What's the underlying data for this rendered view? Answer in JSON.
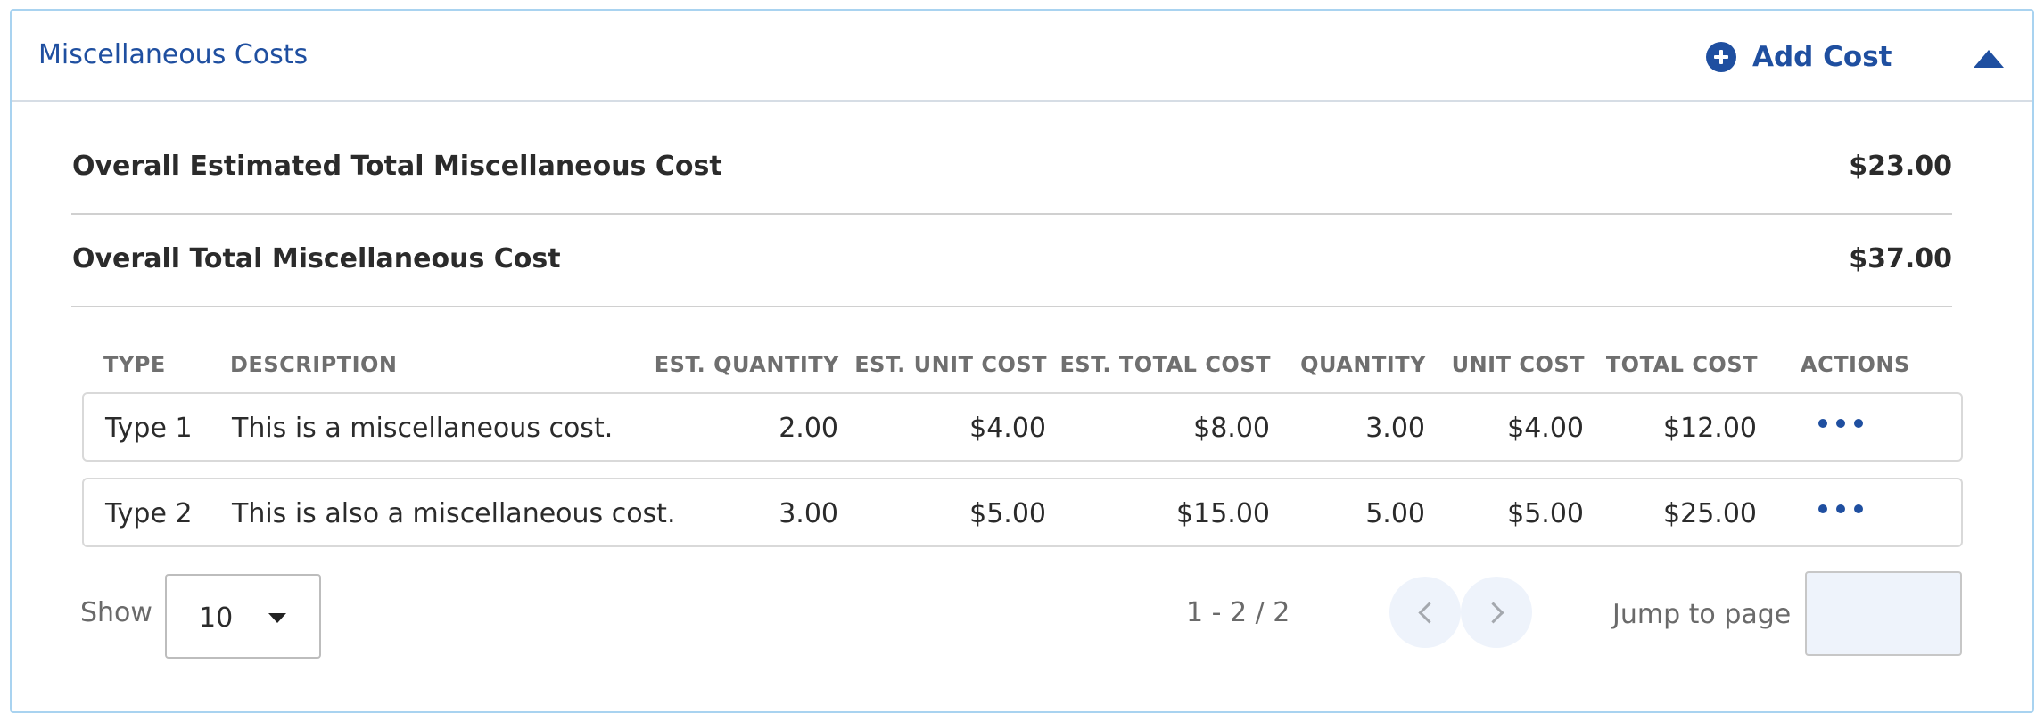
{
  "panel": {
    "title": "Miscellaneous Costs",
    "add_cost_label": "Add Cost"
  },
  "summary": {
    "estimated_label": "Overall Estimated Total Miscellaneous Cost",
    "estimated_value": "$23.00",
    "total_label": "Overall Total Miscellaneous Cost",
    "total_value": "$37.00"
  },
  "table": {
    "headers": [
      "TYPE",
      "DESCRIPTION",
      "EST. QUANTITY",
      "EST. UNIT COST",
      "EST. TOTAL COST",
      "QUANTITY",
      "UNIT COST",
      "TOTAL COST",
      "ACTIONS"
    ],
    "rows": [
      [
        "Type 1",
        "This is a miscellaneous cost.",
        "2.00",
        "$4.00",
        "$8.00",
        "3.00",
        "$4.00",
        "$12.00"
      ],
      [
        "Type 2",
        "This is also a miscellaneous cost.",
        "3.00",
        "$5.00",
        "$15.00",
        "5.00",
        "$5.00",
        "$25.00"
      ]
    ]
  },
  "pagination": {
    "show_label": "Show",
    "page_size": "10",
    "range": "1 - 2 / 2",
    "jump_label": "Jump to page",
    "jump_value": ""
  },
  "icons": {
    "add": "plus-circle-icon",
    "collapse": "caret-up-icon",
    "actions": "more-horizontal-icon",
    "prev": "chevron-left-icon",
    "next": "chevron-right-icon",
    "dropdown": "caret-down-icon"
  },
  "colors": {
    "accent": "#1f4fa0",
    "panel_border": "#a9d3f0",
    "pager_bg": "#eef3fb"
  }
}
